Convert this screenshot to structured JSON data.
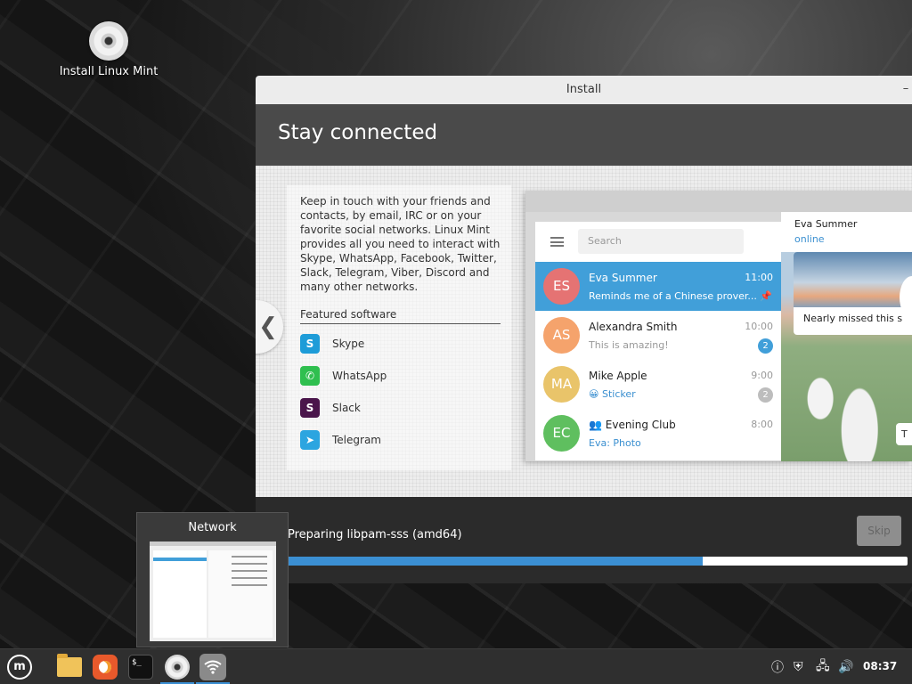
{
  "desktop": {
    "icon_label": "Install Linux Mint",
    "icon": "disc-icon"
  },
  "window": {
    "title": "Install",
    "minimize_glyph": "–",
    "header_title": "Stay connected",
    "slide": {
      "description": "Keep in touch with your friends and contacts, by email, IRC or on your favorite social networks. Linux Mint provides all you need to interact with Skype, WhatsApp, Facebook, Twitter, Slack, Telegram, Viber, Discord and many other networks.",
      "featured_title": "Featured software",
      "featured": [
        {
          "label": "Skype",
          "icon": "skype-icon",
          "color": "#1e9cd8",
          "glyph": "S"
        },
        {
          "label": "WhatsApp",
          "icon": "whatsapp-icon",
          "color": "#2fbf4f",
          "glyph": "✆"
        },
        {
          "label": "Slack",
          "icon": "slack-icon",
          "color": "#4a154b",
          "glyph": "S"
        },
        {
          "label": "Telegram",
          "icon": "telegram-icon",
          "color": "#2ca5e0",
          "glyph": "➤"
        }
      ],
      "prev_glyph": "❮",
      "telegram": {
        "search_placeholder": "Search",
        "chats": [
          {
            "initials": "ES",
            "name": "Eva Summer",
            "time": "11:00",
            "message": "Reminds me of a Chinese prover...",
            "avatar_color": "#e57373",
            "badge": "",
            "pinned": "📌"
          },
          {
            "initials": "AS",
            "name": "Alexandra Smith",
            "time": "10:00",
            "message": "This is amazing!",
            "avatar_color": "#f5a36c",
            "badge": "2"
          },
          {
            "initials": "MA",
            "name": "Mike Apple",
            "time": "9:00",
            "message": "😀 Sticker",
            "avatar_color": "#e9c46a",
            "badge": "2"
          },
          {
            "initials": "EC",
            "name": "👥 Evening Club",
            "time": "8:00",
            "message": "Eva: Photo",
            "avatar_color": "#5fbf5f",
            "badge": ""
          }
        ],
        "conversation": {
          "name": "Eva Summer",
          "status": "online",
          "caption": "Nearly missed this s",
          "tip": "T"
        }
      }
    },
    "progress": {
      "label": "Preparing libpam-sss (amd64)",
      "fraction": 0.67
    },
    "skip_label": "Skip"
  },
  "preview": {
    "title": "Network"
  },
  "taskbar": {
    "launchers": [
      {
        "name": "mint-menu",
        "icon": "mint-menu-icon"
      },
      {
        "name": "files",
        "icon": "folder-icon"
      },
      {
        "name": "firefox",
        "icon": "firefox-icon"
      },
      {
        "name": "terminal",
        "icon": "terminal-icon"
      },
      {
        "name": "installer",
        "icon": "disc-icon"
      },
      {
        "name": "network",
        "icon": "wifi-icon"
      }
    ],
    "mint_label": "m",
    "terminal_glyph": "$_",
    "tray": {
      "update": "ⓘ",
      "shield": "⛨",
      "network": "🖧",
      "volume": "🔊"
    },
    "clock": "08:37"
  },
  "colors": {
    "accent": "#3b8fd3",
    "telegram_blue": "#419fd9"
  }
}
